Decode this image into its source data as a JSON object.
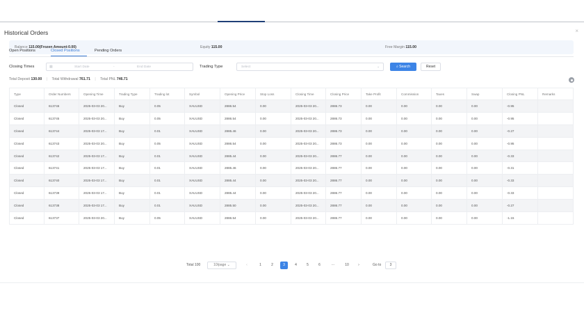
{
  "window": {
    "title": "Historical Orders",
    "close_symbol": "×"
  },
  "summary": {
    "balance_label": "Balance",
    "balance_value": "115.00(Frozen Amount:0.00)",
    "equity_label": "Equity",
    "equity_value": "115.00",
    "free_margin_label": "Free Margin",
    "free_margin_value": "115.00"
  },
  "tabs": [
    {
      "label": "Open Positions",
      "active": false
    },
    {
      "label": "Closed Positions",
      "active": true
    },
    {
      "label": "Pending Orders",
      "active": false
    }
  ],
  "filters": {
    "closing_times_label": "Closing Times",
    "start_placeholder": "Start Date",
    "range_separator": "-",
    "end_placeholder": "End Date",
    "trading_type_label": "Trading Type",
    "trading_type_placeholder": "Select",
    "search_label": "Search",
    "reset_label": "Reset"
  },
  "totals": {
    "deposit_label": "Total Deposit",
    "deposit_value": "130.00",
    "withdrawal_label": "Total Withdrawal",
    "withdrawal_value": "761.71",
    "pnl_label": "Total PNL",
    "pnl_value": "746.71"
  },
  "table": {
    "columns": [
      "Type",
      "Order Numbers",
      "Opening Time",
      "Trading Type",
      "Trading lot",
      "Symbol",
      "Opening Price",
      "Stop Loss",
      "Closing Time",
      "Closing Price",
      "Take Profit",
      "Commission",
      "Taxes",
      "Swap",
      "Closing PNL",
      "Remarks"
    ],
    "rows": [
      [
        "Closed",
        "613746",
        "2025-03-03 20...",
        "Buy",
        "0.05",
        "XAUUSD",
        "2886.54",
        "0.00",
        "2025-03-03 20...",
        "2886.73",
        "0.00",
        "0.00",
        "0.00",
        "0.00",
        "-0.95",
        ""
      ],
      [
        "Closed",
        "613745",
        "2025-03-03 20...",
        "Buy",
        "0.05",
        "XAUUSD",
        "2886.54",
        "0.00",
        "2025-03-03 20...",
        "2886.73",
        "0.00",
        "0.00",
        "0.00",
        "0.00",
        "-0.95",
        ""
      ],
      [
        "Closed",
        "613744",
        "2025-03-03 17...",
        "Buy",
        "0.01",
        "XAUUSD",
        "2885.46",
        "0.00",
        "2025-03-03 20...",
        "2886.73",
        "0.00",
        "0.00",
        "0.00",
        "0.00",
        "-0.27",
        ""
      ],
      [
        "Closed",
        "613743",
        "2025-03-03 20...",
        "Buy",
        "0.05",
        "XAUUSD",
        "2886.54",
        "0.00",
        "2025-03-03 20...",
        "2886.73",
        "0.00",
        "0.00",
        "0.00",
        "0.00",
        "-0.95",
        ""
      ],
      [
        "Closed",
        "613742",
        "2025-03-03 17...",
        "Buy",
        "0.01",
        "XAUUSD",
        "2885.44",
        "0.00",
        "2025-03-03 20...",
        "2886.77",
        "0.00",
        "0.00",
        "0.00",
        "0.00",
        "-0.33",
        ""
      ],
      [
        "Closed",
        "613741",
        "2025-03-03 17...",
        "Buy",
        "0.01",
        "XAUUSD",
        "2885.46",
        "0.00",
        "2025-03-03 20...",
        "2886.77",
        "0.00",
        "0.00",
        "0.00",
        "0.00",
        "-0.31",
        ""
      ],
      [
        "Closed",
        "613740",
        "2025-03-03 17...",
        "Buy",
        "0.01",
        "XAUUSD",
        "2885.44",
        "0.00",
        "2025-03-03 20...",
        "2886.77",
        "0.00",
        "0.00",
        "0.00",
        "0.00",
        "-0.33",
        ""
      ],
      [
        "Closed",
        "613739",
        "2025-03-03 17...",
        "Buy",
        "0.01",
        "XAUUSD",
        "2885.44",
        "0.00",
        "2025-03-03 20...",
        "2886.77",
        "0.00",
        "0.00",
        "0.00",
        "0.00",
        "-0.33",
        ""
      ],
      [
        "Closed",
        "613738",
        "2025-03-03 17...",
        "Buy",
        "0.01",
        "XAUUSD",
        "2885.50",
        "0.00",
        "2025-03-03 20...",
        "2886.77",
        "0.00",
        "0.00",
        "0.00",
        "0.00",
        "-0.27",
        ""
      ],
      [
        "Closed",
        "613737",
        "2025-03-03 20...",
        "Buy",
        "0.05",
        "XAUUSD",
        "2886.54",
        "0.00",
        "2025-03-03 20...",
        "2886.77",
        "0.00",
        "0.00",
        "0.00",
        "0.00",
        "-1.15",
        ""
      ]
    ]
  },
  "pagination": {
    "total_text": "Total 100",
    "page_size": "10/page",
    "prev": "‹",
    "next": "›",
    "pages": [
      "1",
      "2",
      "3",
      "4",
      "5",
      "6",
      "···",
      "10"
    ],
    "current_page": "3",
    "goto_label": "Go to",
    "goto_value": "3"
  },
  "colors": {
    "accent": "#3c84e6",
    "summary_bg": "#f2f6fc",
    "stripe": "#f3f4f6"
  }
}
